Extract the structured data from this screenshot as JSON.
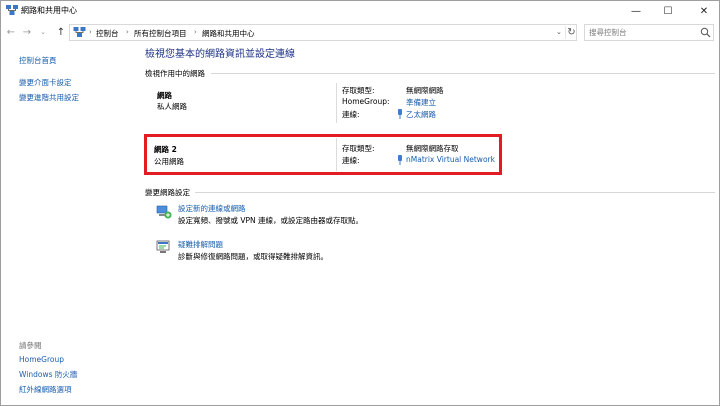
{
  "window": {
    "title": "網路和共用中心",
    "minimize": "—",
    "maximize": "☐",
    "close": "✕"
  },
  "nav": {
    "back": "←",
    "forward": "→",
    "recent": "⌄",
    "up": "↑",
    "breadcrumbs": [
      "控制台",
      "所有控制台項目",
      "網路和共用中心"
    ],
    "separator": "›",
    "dropdown": "⌄",
    "refresh": "↻",
    "search_placeholder": "搜尋控制台"
  },
  "sidebar": {
    "home": "控制台首頁",
    "links": [
      "變更介面卡設定",
      "變更進階共用設定"
    ],
    "see_also_title": "請參閱",
    "see_also": [
      "HomeGroup",
      "Windows 防火牆",
      "紅外線網路選項"
    ]
  },
  "main": {
    "title": "檢視您基本的網路資訊並設定連線",
    "active_networks_heading": "檢視作用中的網路",
    "networks": [
      {
        "name": "網路",
        "type": "私人網路",
        "access_label": "存取類型:",
        "access_value": "無網際網路",
        "homegroup_label": "HomeGroup:",
        "homegroup_value": "準備建立",
        "connection_label": "連線:",
        "connection_value": "乙太網路"
      },
      {
        "name": "網路 2",
        "type": "公用網路",
        "access_label": "存取類型:",
        "access_value": "無網際網路存取",
        "connection_label": "連線:",
        "connection_value": "nMatrix Virtual Network"
      }
    ],
    "change_heading": "變更網路設定",
    "tasks": [
      {
        "link": "設定新的連線或網路",
        "desc": "設定寬頻、撥號或 VPN 連線，或設定路由器或存取點。",
        "icon": "network-setup-icon"
      },
      {
        "link": "疑難排解問題",
        "desc": "診斷與修復網路問題，或取得疑難排解資訊。",
        "icon": "troubleshoot-icon"
      }
    ]
  },
  "colors": {
    "link": "#1a5dad",
    "title": "#1e3287",
    "highlight_border": "#e31c23"
  }
}
